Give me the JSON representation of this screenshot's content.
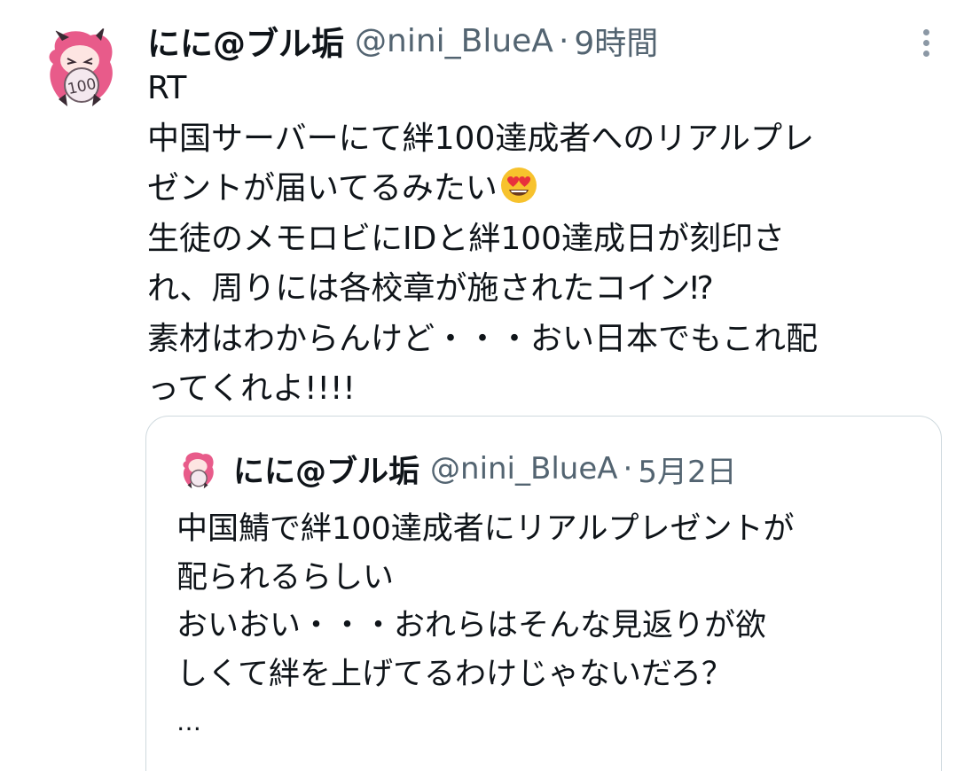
{
  "tweet": {
    "author_name": "にに@ブル垢",
    "handle": "@nini_BlueA",
    "separator": "·",
    "time": "9時間",
    "avatar_icon": "anime-avatar-icon",
    "more_icon": "more-vertical-icon",
    "lines": [
      "RT",
      "中国サーバーにて絆100達成者へのリアルプレ",
      "ゼントが届いてるみたい",
      "生徒のメモロビにIDと絆100達成日が刻印さ",
      "れ、周りには各校章が施されたコイン⁉︎",
      "素材はわからんけど・・・おい日本でもこれ配",
      "ってくれよ!!!!"
    ],
    "emoji_icon": "heart-eyes-emoji-icon",
    "avatar_badge": "100"
  },
  "quote": {
    "author_name": "にに@ブル垢",
    "handle": "@nini_BlueA",
    "separator": "·",
    "time": "5月2日",
    "lines": [
      "中国鯖で絆100達成者にリアルプレゼントが",
      "配られるらしい",
      "おいおい・・・おれらはそんな見返りが欲",
      "しくて絆を上げてるわけじゃないだろ？",
      "…"
    ]
  },
  "colors": {
    "text_primary": "#0f1419",
    "text_secondary": "#536471",
    "border": "#cfd9de",
    "avatar_pink": "#e85b8a"
  }
}
